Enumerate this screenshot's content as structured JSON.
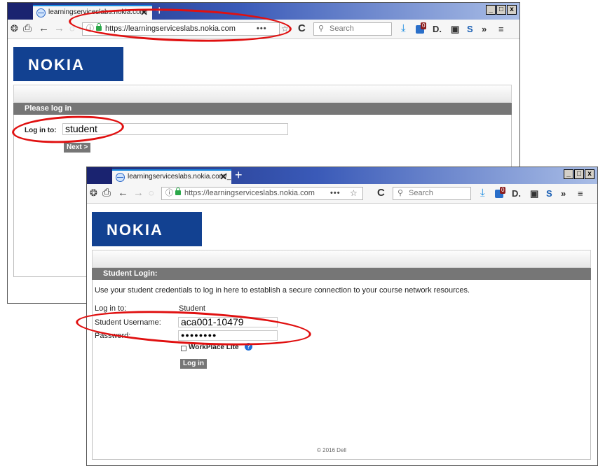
{
  "window1": {
    "tab_title": "learningserviceslabs.nokia.com/",
    "url": "https://learningserviceslabs.nokia.com",
    "search_placeholder": "Search",
    "logo": "NOKIA",
    "section_header": "Please log in",
    "login_label": "Log in to:",
    "login_value": "student",
    "next_button": "Next >"
  },
  "window2": {
    "tab_title": "learningserviceslabs.nokia.com/_",
    "url": "https://learningserviceslabs.nokia.com",
    "search_placeholder": "Search",
    "logo": "NOKIA",
    "section_header": "Student Login:",
    "instructions": "Use your student credentials to log in here to establish a secure connection to your course network resources.",
    "login_to_label": "Log in to:",
    "login_to_value": "Student",
    "username_label": "Student Username:",
    "username_value": "aca001-10479",
    "password_label": "Password:",
    "password_value": "●●●●●●●●",
    "workplace_label": "WorkPlace Lite",
    "login_button": "Log in",
    "footer": "© 2016 Dell"
  },
  "toolbar_icons": [
    "bot-icon",
    "print-icon",
    "back-icon",
    "forward-icon",
    "home-icon",
    "info-icon",
    "lock-icon",
    "more-icon",
    "bookmark-icon",
    "reload-icon",
    "search-icon",
    "download-icon",
    "extension-badge-icon",
    "d-icon",
    "reader-icon",
    "s-icon",
    "overflow-icon",
    "menu-icon"
  ],
  "extension_badge_count": "0",
  "annotation_color": "#e01010",
  "brand_color": "#124191"
}
